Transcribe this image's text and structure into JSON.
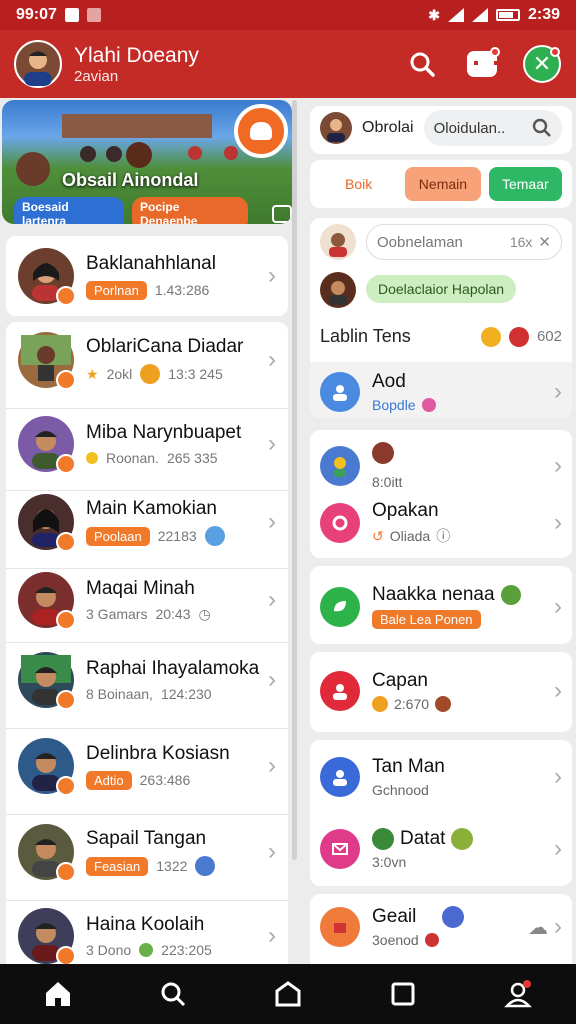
{
  "status_bar": {
    "time_left": "99:07",
    "time_right": "2:39"
  },
  "header": {
    "title": "Ylahi Doeany",
    "subtitle": "2avian"
  },
  "banner": {
    "title": "Obsail Ainondal",
    "chip_blue": "Boesaid lartenra",
    "chip_orange": "Pocipe Denaenbe"
  },
  "contacts": [
    {
      "name": "Baklanahhlanal",
      "tag": "Porlnan",
      "meta": "1.43:286",
      "color": "#6b3e2e"
    },
    {
      "name": "OblariCana Diadar",
      "meta": "2okl",
      "time": "13:3 245",
      "color": "#9b6a3e"
    },
    {
      "name": "Miba Narynbuapet",
      "meta": "Roonan.",
      "time": "265 335",
      "color": "#3e5a2e"
    },
    {
      "name": "Main Kamokian",
      "tag": "Poolaan",
      "time": "22183",
      "color": "#4a2e2e"
    },
    {
      "name": "Maqai Minah",
      "meta": "3 Gamars",
      "time": "20:43",
      "color": "#7a2e2e"
    },
    {
      "name": "Raphai Ihayalamoka",
      "meta": "8 Boinaan,",
      "time": "124:230",
      "color": "#2e4a5a"
    },
    {
      "name": "Delinbra Kosiasn",
      "tag": "Adtio",
      "time": "263:486",
      "color": "#2e5a8a"
    },
    {
      "name": "Sapail Tangan",
      "tag": "Feasian",
      "time": "1322",
      "color": "#5a5a3e"
    },
    {
      "name": "Haina Koolaih",
      "meta": "3 Dono",
      "time": "223:205",
      "color": "#3e3e5a"
    }
  ],
  "right": {
    "top_name": "Obrolai",
    "top_search": "Oloidulan..",
    "tabs": [
      "Boik",
      "Nemain",
      "Temaar"
    ],
    "chat_placeholder": "Oobnelaman",
    "chat_count": "16x",
    "green_pill": "Doelaclaior Hapolan",
    "labels_title": "Lablin Tens",
    "labels_count": "602",
    "add_title": "Aod",
    "add_sub": "Bopdle",
    "item1_sub": "8:0itt",
    "item2_title": "Opakan",
    "item2_sub": "Oliada",
    "item3_title": "Naakka nenaa",
    "item3_tag": "Bale Lea Ponen",
    "item4_title": "Capan",
    "item4_sub": "2:670",
    "item5_title": "Tan Man",
    "item5_sub": "Gchnood",
    "item6_title": "Datat",
    "item6_sub": "3:0vn",
    "item7_title": "Geail",
    "item7_sub": "3oenod"
  },
  "colors": {
    "brand_red": "#c42a26",
    "accent_orange": "#f07a2a",
    "accent_green": "#2eaf52"
  }
}
